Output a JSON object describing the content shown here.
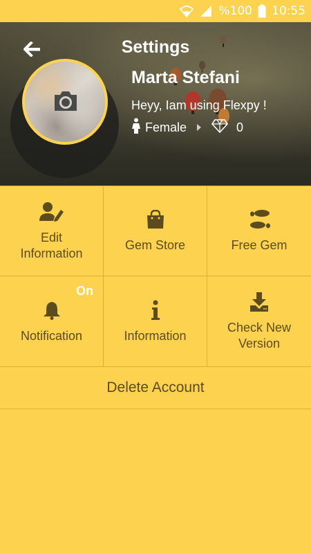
{
  "status_bar": {
    "battery_text": "%100",
    "time": "10:55",
    "icons": [
      "wifi-icon",
      "signal-icon",
      "battery-icon"
    ]
  },
  "header": {
    "title": "Settings",
    "back_icon": "arrow-left-icon"
  },
  "profile": {
    "name": "Marta Stefani",
    "status_message": "Heyy, Iam using Flexpy !",
    "gender": "Female",
    "gem_count": "0",
    "camera_icon": "camera-icon"
  },
  "menu": {
    "items": [
      {
        "label": "Edit\nInformation",
        "icon": "edit-user-icon"
      },
      {
        "label": "Gem Store",
        "icon": "shopping-bag-icon"
      },
      {
        "label": "Free Gem",
        "icon": "footprints-icon"
      },
      {
        "label": "Notification",
        "icon": "bell-icon",
        "badge": "On"
      },
      {
        "label": "Information",
        "icon": "info-icon"
      },
      {
        "label": "Check New\nVersion",
        "icon": "download-icon"
      }
    ],
    "delete_label": "Delete Account"
  },
  "colors": {
    "background": "#FDD24F",
    "text": "#5C4B1C",
    "accent_white": "#FFFFFF"
  }
}
